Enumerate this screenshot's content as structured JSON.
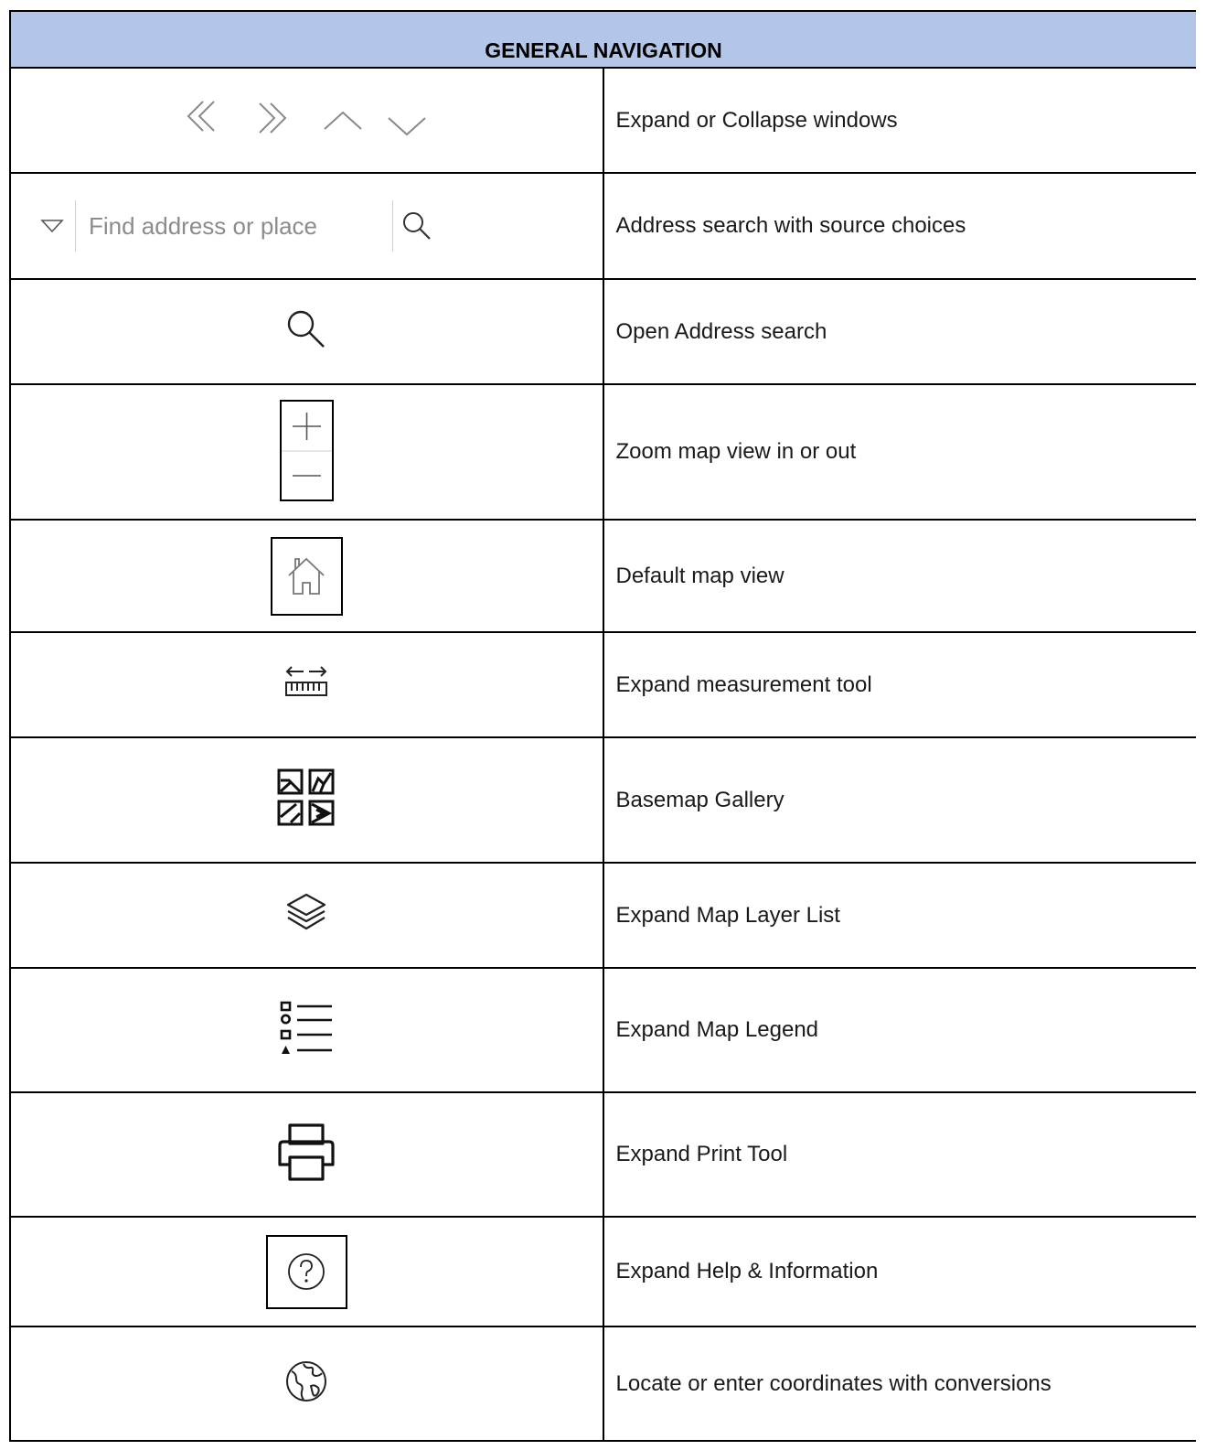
{
  "header": {
    "title": "GENERAL NAVIGATION"
  },
  "search": {
    "placeholder": "Find address or place"
  },
  "rows": [
    {
      "icon": "expand-collapse-chevrons-icon",
      "description": "Expand or Collapse windows"
    },
    {
      "icon": "address-search-bar",
      "description": "Address search with source choices"
    },
    {
      "icon": "search-icon",
      "description": "Open Address search"
    },
    {
      "icon": "zoom-in-out-icon",
      "description": "Zoom map view in or out"
    },
    {
      "icon": "home-icon",
      "description": "Default map view"
    },
    {
      "icon": "measure-ruler-icon",
      "description": "Expand measurement tool"
    },
    {
      "icon": "basemap-gallery-icon",
      "description": "Basemap Gallery"
    },
    {
      "icon": "layers-icon",
      "description": "Expand Map Layer List"
    },
    {
      "icon": "legend-icon",
      "description": "Expand Map Legend"
    },
    {
      "icon": "printer-icon",
      "description": "Expand Print Tool"
    },
    {
      "icon": "help-icon",
      "description": "Expand Help & Information"
    },
    {
      "icon": "globe-icon",
      "description": "Locate or enter coordinates with conversions"
    }
  ]
}
